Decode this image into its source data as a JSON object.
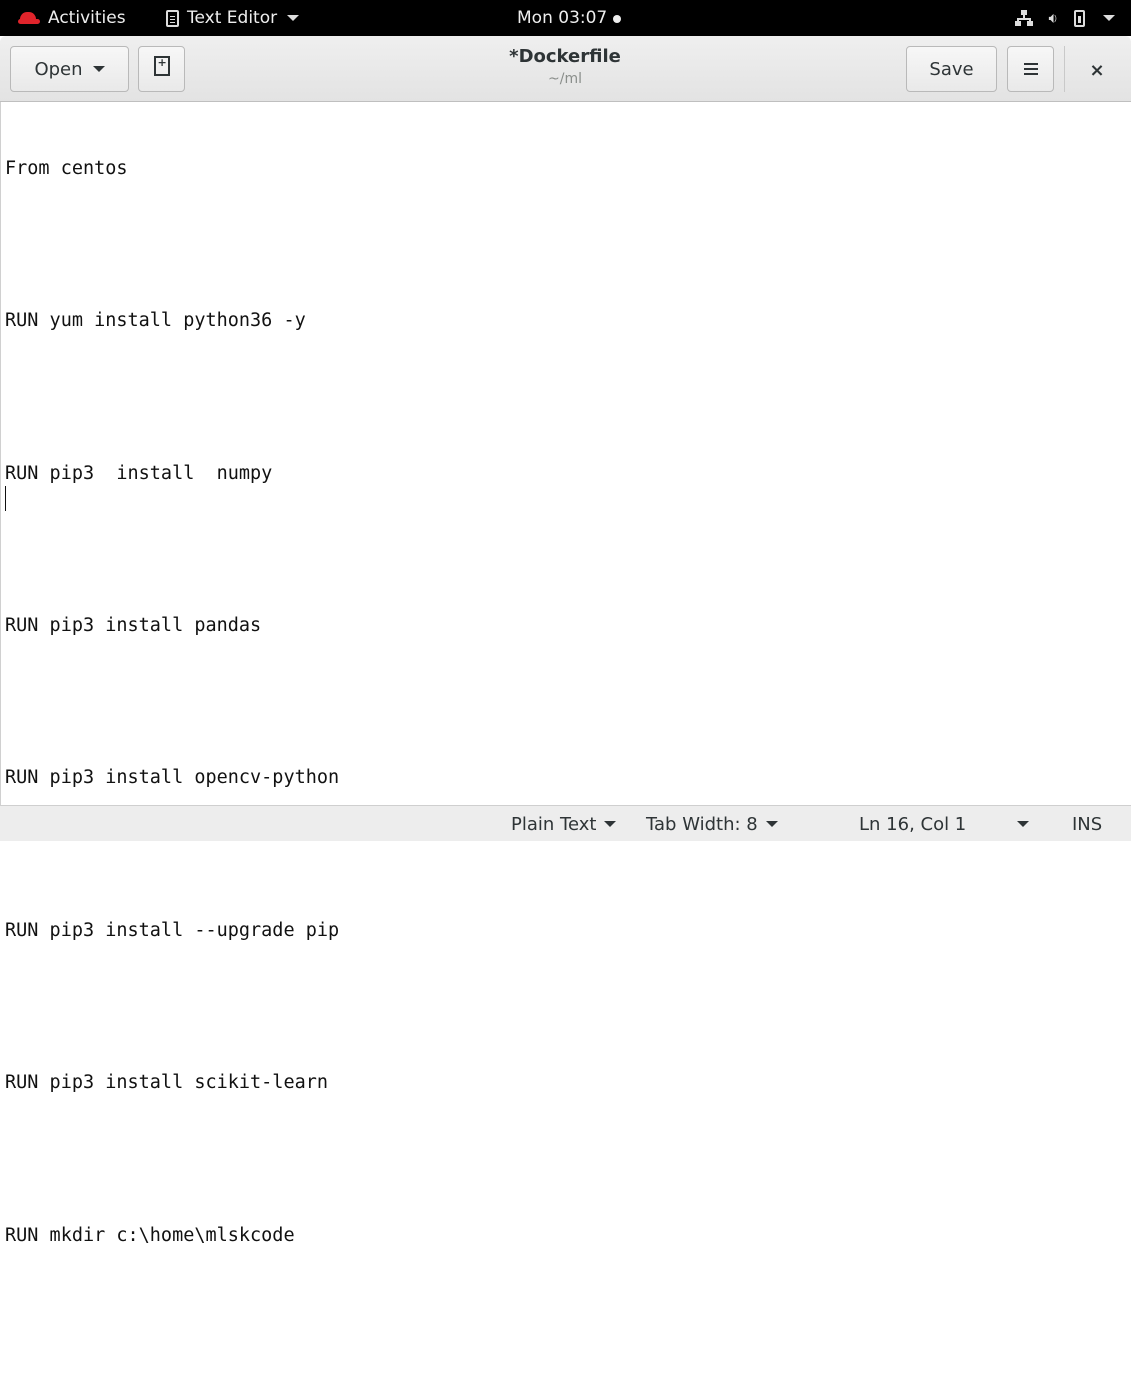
{
  "topbar": {
    "activities": "Activities",
    "app_name": "Text Editor",
    "clock": "Mon 03:07"
  },
  "headerbar": {
    "open_label": "Open",
    "title": "*Dockerfile",
    "subtitle": "~/ml",
    "save_label": "Save",
    "close_glyph": "×"
  },
  "editor": {
    "lines": [
      "From centos",
      "",
      "RUN yum install python36 -y",
      "",
      "RUN pip3  install  numpy",
      "",
      "RUN pip3 install pandas",
      "",
      "RUN pip3 install opencv-python",
      "",
      "RUN pip3 install --upgrade pip",
      "",
      "RUN pip3 install scikit-learn",
      "",
      "RUN mkdir c:\\home\\mlskcode",
      ""
    ]
  },
  "statusbar": {
    "language": "Plain Text",
    "tab_width": "Tab Width: 8",
    "position": "Ln 16, Col 1",
    "mode": "INS"
  }
}
